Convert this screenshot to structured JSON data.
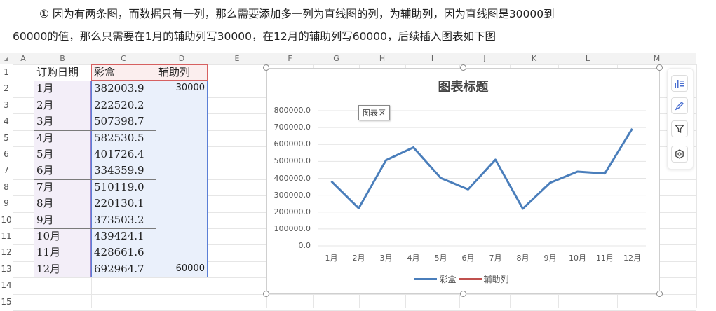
{
  "intro": {
    "line1": "① 因为有两条图，而数据只有一列，那么需要添加多一列为直线图的列，为辅助列，因为直线图是30000到",
    "line2": "60000的值，那么只需要在1月的辅助列写30000，在12月的辅助列写60000，后续插入图表如下图"
  },
  "columns": [
    "A",
    "B",
    "C",
    "D",
    "E",
    "F",
    "G",
    "H",
    "I",
    "J",
    "K",
    "L",
    "M"
  ],
  "corner": "◢",
  "rows": [
    "1",
    "2",
    "3",
    "4",
    "5",
    "6",
    "7",
    "8",
    "9",
    "10",
    "11",
    "12",
    "13",
    "14",
    "15"
  ],
  "table": {
    "headers": [
      "订购日期",
      "彩盒",
      "辅助列"
    ],
    "data": [
      [
        "1月",
        "382003.9",
        "30000"
      ],
      [
        "2月",
        "222520.2",
        ""
      ],
      [
        "3月",
        "507398.7",
        ""
      ],
      [
        "4月",
        "582530.5",
        ""
      ],
      [
        "5月",
        "401726.4",
        ""
      ],
      [
        "6月",
        "334359.9",
        ""
      ],
      [
        "7月",
        "510119.0",
        ""
      ],
      [
        "8月",
        "220130.1",
        ""
      ],
      [
        "9月",
        "373503.2",
        ""
      ],
      [
        "10月",
        "439424.1",
        ""
      ],
      [
        "11月",
        "428661.6",
        ""
      ],
      [
        "12月",
        "692964.7",
        "60000"
      ]
    ]
  },
  "chart_data": {
    "type": "line",
    "title": "图表标题",
    "categories": [
      "1月",
      "2月",
      "3月",
      "4月",
      "5月",
      "6月",
      "7月",
      "8月",
      "9月",
      "10月",
      "11月",
      "12月"
    ],
    "series": [
      {
        "name": "彩盒",
        "color": "#4a7ebb",
        "values": [
          382003.9,
          222520.2,
          507398.7,
          582530.5,
          401726.4,
          334359.9,
          510119.0,
          220130.1,
          373503.2,
          439424.1,
          428661.6,
          692964.7
        ]
      },
      {
        "name": "辅助列",
        "color": "#c0504d",
        "values": [
          30000,
          null,
          null,
          null,
          null,
          null,
          null,
          null,
          null,
          null,
          null,
          60000
        ]
      }
    ],
    "yticks": [
      "0.0",
      "100000.0",
      "200000.0",
      "300000.0",
      "400000.0",
      "500000.0",
      "600000.0",
      "700000.0",
      "800000.0"
    ],
    "ylim": [
      0,
      800000
    ],
    "grid": true,
    "legend": "bottom"
  },
  "tooltip": "图表区",
  "tools": [
    "chart-elements-icon",
    "chart-style-icon",
    "chart-filter-icon",
    "chart-settings-icon"
  ]
}
